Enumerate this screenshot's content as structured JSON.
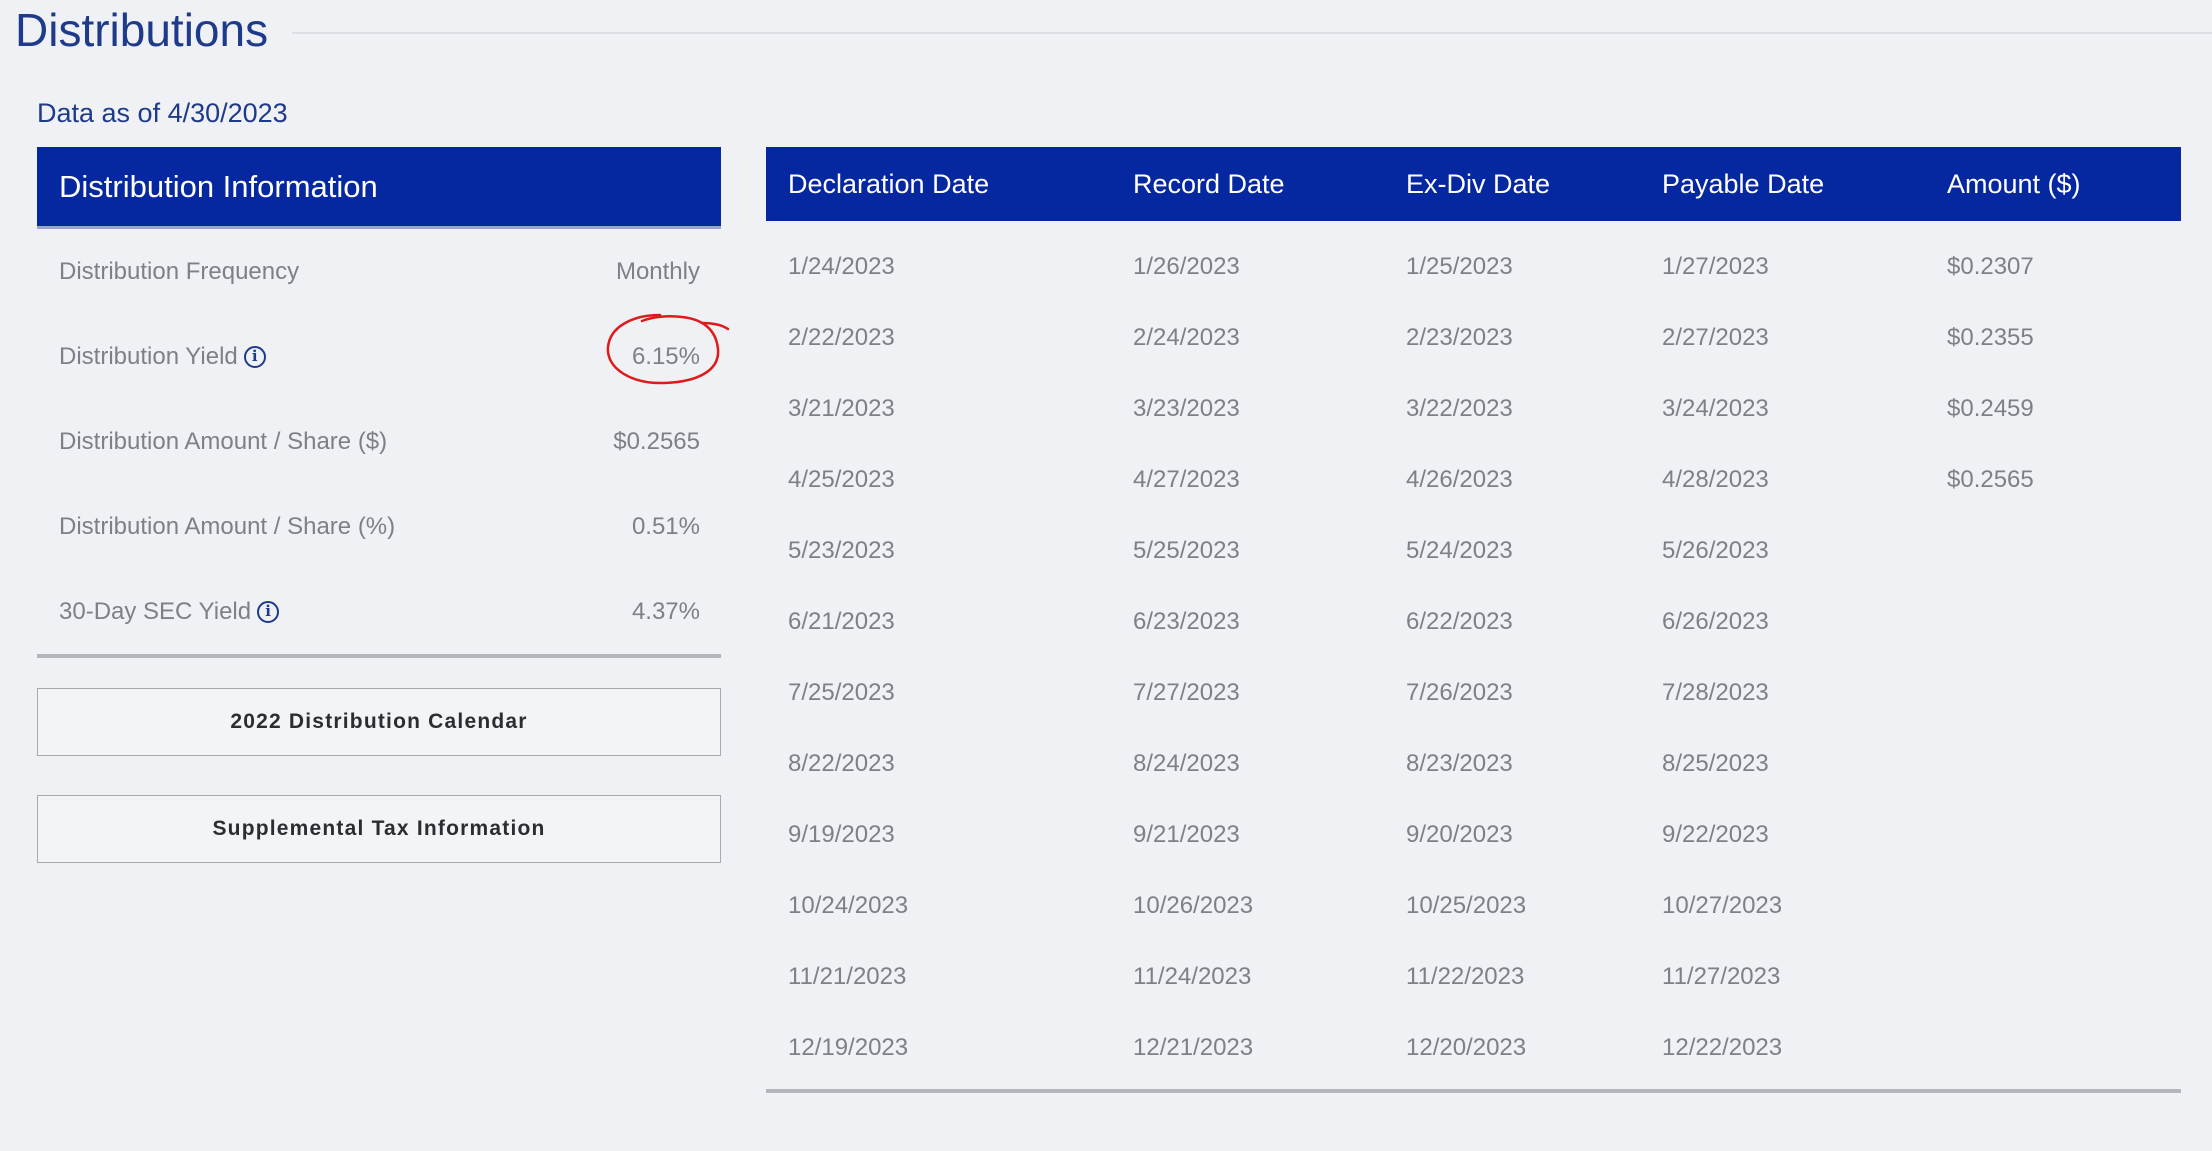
{
  "page": {
    "title": "Distributions",
    "as_of": "Data as of 4/30/2023"
  },
  "info_panel": {
    "header": "Distribution Information",
    "rows": [
      {
        "label": "Distribution Frequency",
        "value": "Monthly",
        "has_info_icon": false
      },
      {
        "label": "Distribution Yield",
        "value": "6.15%",
        "has_info_icon": true,
        "highlighted": true
      },
      {
        "label": "Distribution Amount / Share ($)",
        "value": "$0.2565",
        "has_info_icon": false
      },
      {
        "label": "Distribution Amount / Share (%)",
        "value": "0.51%",
        "has_info_icon": false
      },
      {
        "label": "30-Day SEC Yield",
        "value": "4.37%",
        "has_info_icon": true
      }
    ],
    "info_icon_glyph": "i"
  },
  "buttons": {
    "calendar": "2022 Distribution Calendar",
    "tax": "Supplemental Tax Information"
  },
  "table": {
    "headers": [
      "Declaration Date",
      "Record Date",
      "Ex-Div Date",
      "Payable Date",
      "Amount ($)"
    ],
    "rows": [
      [
        "1/24/2023",
        "1/26/2023",
        "1/25/2023",
        "1/27/2023",
        "$0.2307"
      ],
      [
        "2/22/2023",
        "2/24/2023",
        "2/23/2023",
        "2/27/2023",
        "$0.2355"
      ],
      [
        "3/21/2023",
        "3/23/2023",
        "3/22/2023",
        "3/24/2023",
        "$0.2459"
      ],
      [
        "4/25/2023",
        "4/27/2023",
        "4/26/2023",
        "4/28/2023",
        "$0.2565"
      ],
      [
        "5/23/2023",
        "5/25/2023",
        "5/24/2023",
        "5/26/2023",
        ""
      ],
      [
        "6/21/2023",
        "6/23/2023",
        "6/22/2023",
        "6/26/2023",
        ""
      ],
      [
        "7/25/2023",
        "7/27/2023",
        "7/26/2023",
        "7/28/2023",
        ""
      ],
      [
        "8/22/2023",
        "8/24/2023",
        "8/23/2023",
        "8/25/2023",
        ""
      ],
      [
        "9/19/2023",
        "9/21/2023",
        "9/20/2023",
        "9/22/2023",
        ""
      ],
      [
        "10/24/2023",
        "10/26/2023",
        "10/25/2023",
        "10/27/2023",
        ""
      ],
      [
        "11/21/2023",
        "11/24/2023",
        "11/22/2023",
        "11/27/2023",
        ""
      ],
      [
        "12/19/2023",
        "12/21/2023",
        "12/20/2023",
        "12/22/2023",
        ""
      ]
    ]
  },
  "colors": {
    "header_bg": "#0527a0",
    "title_text": "#1e3a8a",
    "annotation_circle": "#e01a1a"
  },
  "icons": {
    "info": "info-circle-icon",
    "annotation": "hand-drawn-circle-annotation"
  }
}
